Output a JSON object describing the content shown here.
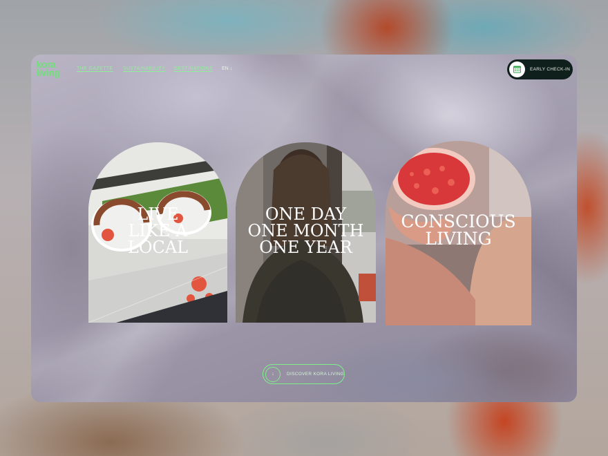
{
  "brand": {
    "line1": "kora",
    "line2": "living",
    "color": "#6fe07a"
  },
  "nav": {
    "links": [
      "THE GAZETTE",
      "SUSTAINABILITY",
      "DESTINATIONS"
    ],
    "language": "EN",
    "language_arrow": "↓"
  },
  "checkin": {
    "label": "EARLY CHECK-IN",
    "icon": "calendar-icon"
  },
  "cards": [
    {
      "lines": [
        "LIVE",
        "LIKE A",
        "LOCAL"
      ]
    },
    {
      "lines": [
        "ONE DAY",
        "ONE MONTH",
        "ONE YEAR"
      ]
    },
    {
      "lines": [
        "CONSCIOUS",
        "LIVING"
      ]
    }
  ],
  "cta": {
    "label": "DISCOVER KORA LIVING",
    "arrow": "↓"
  },
  "colors": {
    "accent": "#7ef08a",
    "dark": "#0f1f1b"
  }
}
